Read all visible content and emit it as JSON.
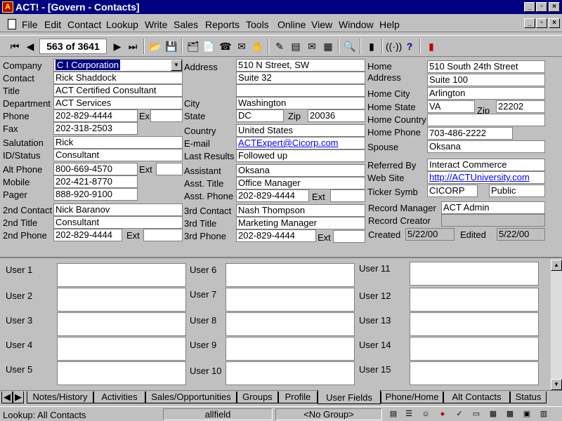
{
  "window": {
    "title": "ACT! - [Govern - Contacts]"
  },
  "menu": [
    "File",
    "Edit",
    "Contact",
    "Lookup",
    "Write",
    "Sales",
    "Reports",
    "Tools",
    "Online",
    "View",
    "Window",
    "Help"
  ],
  "toolbar": {
    "counter": "563 of 3641"
  },
  "contact": {
    "company_label": "Company",
    "company": "C I Corporation",
    "contact_label": "Contact",
    "contact": "Rick Shaddock",
    "title_label": "Title",
    "title": "ACT Certified Consultant",
    "department_label": "Department",
    "department": "ACT Services",
    "phone_label": "Phone",
    "phone": "202-829-4444",
    "phone_ext_label": "Ex",
    "fax_label": "Fax",
    "fax": "202-318-2503",
    "salutation_label": "Salutation",
    "salutation": "Rick",
    "idstatus_label": "ID/Status",
    "idstatus": "Consultant",
    "altphone_label": "Alt Phone",
    "altphone": "800-669-4570",
    "altphone_ext_label": "Ext",
    "mobile_label": "Mobile",
    "mobile": "202-421-8770",
    "pager_label": "Pager",
    "pager": "888-920-9100",
    "contact2_label": "2nd Contact",
    "contact2": "Nick Baranov",
    "title2_label": "2nd Title",
    "title2": "Consultant",
    "phone2_label": "2nd Phone",
    "phone2": "202-829-4444",
    "phone2_ext_label": "Ext",
    "address_label": "Address",
    "address1": "510 N Street, SW",
    "address2": "Suite 32",
    "address3": "",
    "city_label": "City",
    "city": "Washington",
    "state_label": "State",
    "state": "DC",
    "zip_label": "Zip",
    "zip": "20036",
    "country_label": "Country",
    "country": "United States",
    "email_label": "E-mail",
    "email": "ACTExpert@Cicorp.com",
    "lastresults_label": "Last Results",
    "lastresults": "Followed up",
    "assistant_label": "Assistant",
    "assistant": "Oksana",
    "asst_title_label": "Asst. Title",
    "asst_title": "Office Manager",
    "asst_phone_label": "Asst. Phone",
    "asst_phone": "202-829-4444",
    "asst_phone_ext_label": "Ext",
    "contact3_label": "3rd Contact",
    "contact3": "Nash Thompson",
    "title3_label": "3rd Title",
    "title3": "Marketing Manager",
    "phone3_label": "3rd Phone",
    "phone3": "202-829-4444",
    "phone3_ext_label": "Ext",
    "home_label": "Home",
    "home_address_label": "Address",
    "home_address1": "510 South 24th Street",
    "home_address2": "Suite 100",
    "home_city_label": "Home City",
    "home_city": "Arlington",
    "home_state_label": "Home State",
    "home_state": "VA",
    "home_zip_label": "Zip",
    "home_zip": "22202",
    "home_country_label": "Home Country",
    "home_country": "",
    "home_phone_label": "Home Phone",
    "home_phone": "703-486-2222",
    "spouse_label": "Spouse",
    "spouse": "Oksana",
    "referred_label": "Referred By",
    "referred": "Interact Commerce",
    "website_label": "Web Site",
    "website": "http://ACTUniversity.com",
    "ticker_label": "Ticker Symb",
    "ticker": "CICORP",
    "ticker_type": "Public",
    "record_manager_label": "Record Manager",
    "record_manager": "ACT Admin",
    "record_creator_label": "Record Creator",
    "record_creator": "",
    "created_label": "Created",
    "created": "5/22/00",
    "edited_label": "Edited",
    "edited": "5/22/00"
  },
  "user_fields": {
    "col1": [
      "User 1",
      "User 2",
      "User 3",
      "User 4",
      "User 5"
    ],
    "col2": [
      "User 6",
      "User 7",
      "User 8",
      "User 9",
      "User 10"
    ],
    "col3": [
      "User 11",
      "User 12",
      "User 13",
      "User 14",
      "User 15"
    ]
  },
  "tabs": [
    "Notes/History",
    "Activities",
    "Sales/Opportunities",
    "Groups",
    "Profile",
    "User Fields",
    "Phone/Home",
    "Alt Contacts",
    "Status"
  ],
  "status": {
    "lookup": "Lookup: All Contacts",
    "field": "allfield",
    "group": "<No Group>"
  }
}
